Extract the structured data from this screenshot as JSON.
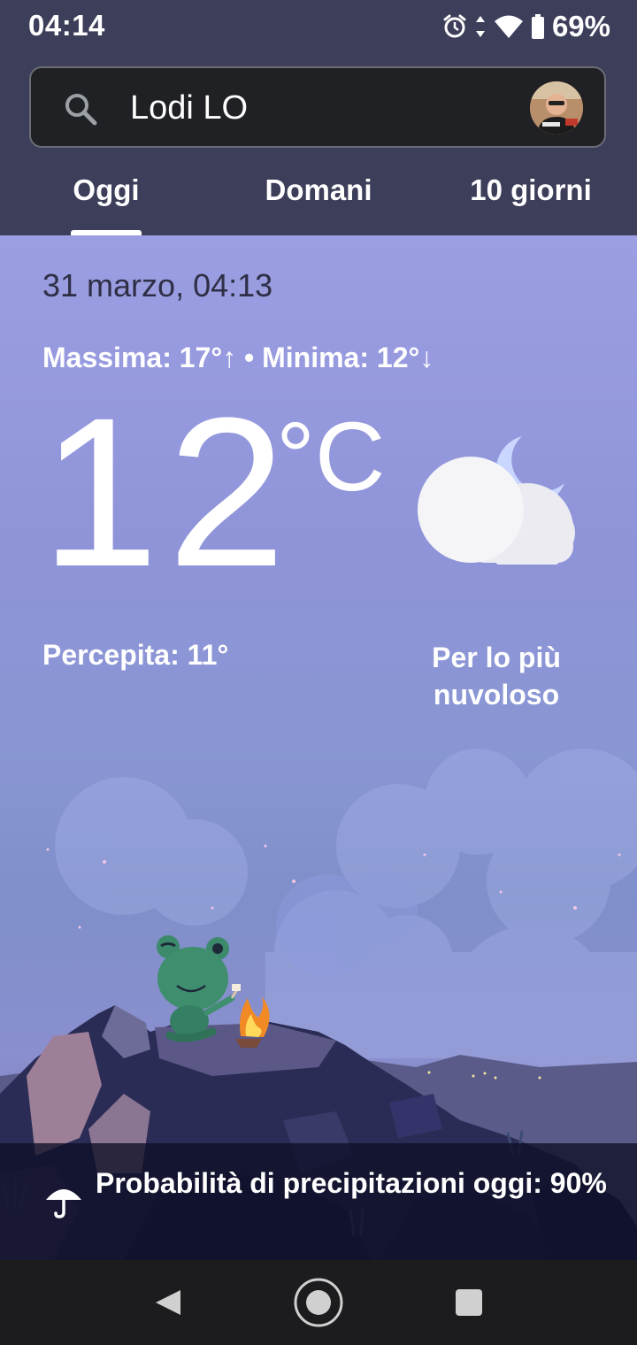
{
  "status_bar": {
    "time": "04:14",
    "battery": "69%",
    "icons": [
      "alarm-icon",
      "data-arrows-icon",
      "wifi-icon",
      "battery-icon"
    ]
  },
  "search": {
    "value": "Lodi LO",
    "icon": "search-icon"
  },
  "tabs": [
    {
      "label": "Oggi",
      "selected": true
    },
    {
      "label": "Domani",
      "selected": false
    },
    {
      "label": "10 giorni",
      "selected": false
    }
  ],
  "weather": {
    "date": "31 marzo, 04:13",
    "high_low": "Massima: 17°↑ • Minima: 12°↓",
    "temperature": "12",
    "unit": "°C",
    "feels_like": "Percepita: 11°",
    "condition": "Per lo più nuvoloso",
    "condition_icon": "partly-cloudy-night-icon"
  },
  "precipitation": {
    "text": "Probabilità di precipitazioni oggi: 90%",
    "icon": "umbrella-icon"
  },
  "nav": {
    "buttons": [
      "back-icon",
      "home-icon",
      "recents-icon"
    ]
  },
  "colors": {
    "header_bg": "#3c3e5a",
    "sky_top": "#9c9ee2",
    "search_bg": "#202124",
    "nav_bg": "#1c1c1e"
  }
}
